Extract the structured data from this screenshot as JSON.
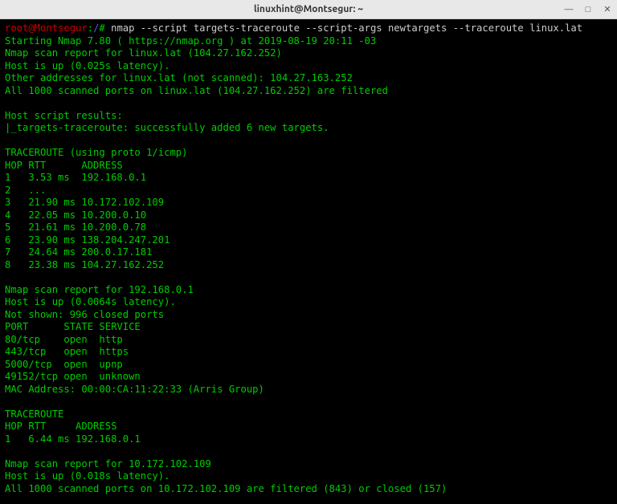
{
  "titlebar": {
    "title": "linuxhint@Montsegur: ~"
  },
  "prompt": {
    "user": "root@Montsegur",
    "sep": ":",
    "path": "/",
    "sym": "# "
  },
  "command": "nmap --script targets-traceroute --script-args newtargets --traceroute linux.lat",
  "lines": {
    "l01": "Starting Nmap 7.80 ( https://nmap.org ) at 2019-08-19 20:11 -03",
    "l02": "Nmap scan report for linux.lat (104.27.162.252)",
    "l03": "Host is up (0.025s latency).",
    "l04": "Other addresses for linux.lat (not scanned): 104.27.163.252",
    "l05": "All 1000 scanned ports on linux.lat (104.27.162.252) are filtered",
    "l06": " ",
    "l07": "Host script results:",
    "l08": "|_targets-traceroute: successfully added 6 new targets.",
    "l09": " ",
    "l10": "TRACEROUTE (using proto 1/icmp)",
    "l11": "HOP RTT      ADDRESS",
    "l12": "1   3.53 ms  192.168.0.1",
    "l13": "2   ...",
    "l14": "3   21.90 ms 10.172.102.109",
    "l15": "4   22.05 ms 10.200.0.10",
    "l16": "5   21.61 ms 10.200.0.78",
    "l17": "6   23.90 ms 138.204.247.201",
    "l18": "7   24.64 ms 200.0.17.181",
    "l19": "8   23.38 ms 104.27.162.252",
    "l20": " ",
    "l21": "Nmap scan report for 192.168.0.1",
    "l22": "Host is up (0.0064s latency).",
    "l23": "Not shown: 996 closed ports",
    "l24": "PORT      STATE SERVICE",
    "l25": "80/tcp    open  http",
    "l26": "443/tcp   open  https",
    "l27": "5000/tcp  open  upnp",
    "l28": "49152/tcp open  unknown",
    "l29": "MAC Address: 00:00:CA:11:22:33 (Arris Group)",
    "l30": " ",
    "l31": "TRACEROUTE",
    "l32": "HOP RTT     ADDRESS",
    "l33": "1   6.44 ms 192.168.0.1",
    "l34": " ",
    "l35": "Nmap scan report for 10.172.102.109",
    "l36": "Host is up (0.018s latency).",
    "l37": "All 1000 scanned ports on 10.172.102.109 are filtered (843) or closed (157)"
  }
}
